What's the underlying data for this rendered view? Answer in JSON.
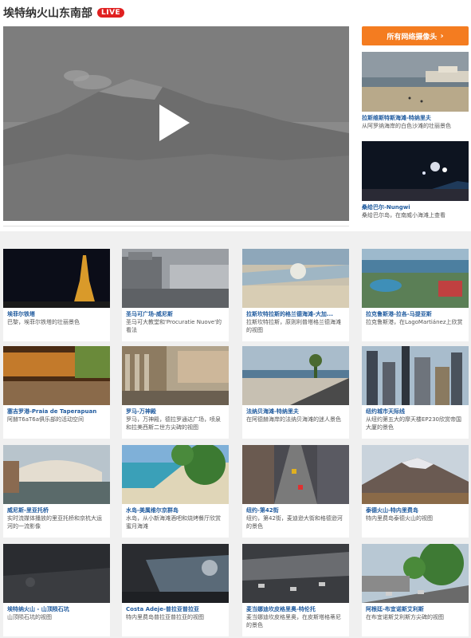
{
  "header": {
    "title": "埃特纳火山东南部",
    "live_badge": "LIVE"
  },
  "player": {
    "play_icon": "play-icon"
  },
  "sidebar": {
    "all_cams_label": "所有网络摄像头",
    "all_cams_chevron": "›",
    "cams": [
      {
        "name": "拉斯维斯特斯海滩-特纳里夫",
        "desc": "从阿罗纳海岸的白色沙滩的壮丽景色"
      },
      {
        "name": "桑给巴尔-Nungwi",
        "desc": "桑给巴尔岛，在南威小海滩上查看"
      }
    ]
  },
  "grid": {
    "cams": [
      {
        "name": "埃菲尔铁塔",
        "desc": "巴黎，埃菲尔铁塔的壮丽景色"
      },
      {
        "name": "圣马可广场-威尼斯",
        "desc": "圣马可大教堂和'Procuratie Nuove'的看法"
      },
      {
        "name": "拉斯坎特拉斯的格兰德海滩-大加...",
        "desc": "拉斯坎特拉斯，原则利普塔格兰德海滩的视图"
      },
      {
        "name": "拉克鲁斯港-拉各-马提亚斯",
        "desc": "拉克鲁斯港，在LagoMartiánez上欣赏"
      },
      {
        "name": "塞吉罗港-Praia de Taperapuan",
        "desc": "阿赫T6aT6a俱乐部的活动空间"
      },
      {
        "name": "罗马-万神殿",
        "desc": "罗马，万神殿，德拉罗通达广场，喷泉和拉美西斯二世方尖碑的视图"
      },
      {
        "name": "法纳贝海滩-特纳里夫",
        "desc": "在阿德赫海岸的法纳贝海滩的迷人景色"
      },
      {
        "name": "纽约城市天际线",
        "desc": "从纽约第五大的摩天楼EP230欣赏帝国大厦的景色"
      },
      {
        "name": "威尼斯-里亚托桥",
        "desc": "实时流媒体播放的里亚托桥和京杭大运河的一流影像"
      },
      {
        "name": "水岛-美属维尔京群岛",
        "desc": "水岛，从小新海滩酒吧和烧烤餐厅欣赏蜜月海滩"
      },
      {
        "name": "纽约-第42街",
        "desc": "纽约，第42街，麦迪逊大街和格德逊河的景色"
      },
      {
        "name": "泰德火山-特内里费岛",
        "desc": "特内里费岛泰德火山的视图"
      },
      {
        "name": "埃特纳火山 - 山顶陨石坑",
        "desc": "山顶陨石坑的视图"
      },
      {
        "name": "Costa Adeje-普拉亚普拉亚",
        "desc": "特内里费岛普拉亚普拉亚的视图"
      },
      {
        "name": "麦当娜迪坎皮格里奥-特伦托",
        "desc": "麦当娜迪坎皮格里奥，在皮斯塔格蒂尼的景色"
      },
      {
        "name": "阿根廷-布宜诺斯艾利斯",
        "desc": "在布宜诺斯艾利斯方尖碑的视图"
      }
    ]
  }
}
